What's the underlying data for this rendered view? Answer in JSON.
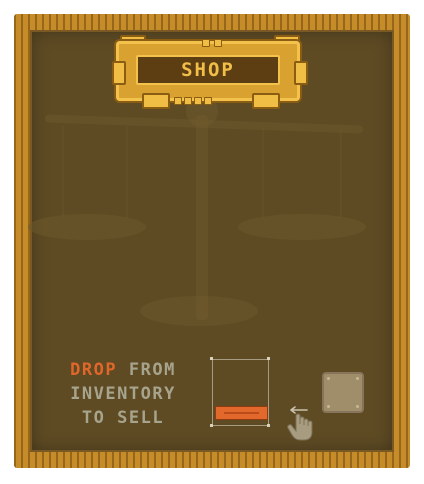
{
  "shop_sign": {
    "title": "SHOP"
  },
  "instructions": {
    "drop_word": "DROP",
    "from_word": "FROM",
    "line2": "INVENTORY",
    "line3": "TO SELL"
  },
  "icons": {
    "scale": "balance-scale-icon",
    "hand": "hand-swipe-icon",
    "item_slot": "inventory-slot-icon"
  },
  "colors": {
    "frame": "#c78c2a",
    "panel": "#5e4b24",
    "sign_gold": "#d9a230",
    "accent_orange": "#e0662a",
    "text_muted": "#a7a48d"
  }
}
